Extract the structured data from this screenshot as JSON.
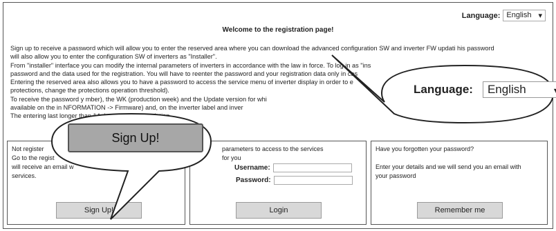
{
  "header": {
    "language_label": "Language:",
    "language_value": "English",
    "title": "Welcome to the registration page!"
  },
  "intro_lines": [
    "Sign up to receive a password which will allow you to enter the reserved area where you can download the advanced configuration SW and inverter FW updati        his password",
    "will also allow you to enter the configuration SW of inverters as \"Installer\".",
    "From \"installer\" interface you can modify the internal parameters of inverters in accordance with the law in force. To log in as \"ins",
    "password and the data used for the registration. You will have to reenter the password and your registration data only in cas",
    "Entering the reserved area also allows you to have a password to access the service menu of inverter display in order to e",
    "protections, change the protections operation threshold).",
    "To receive the password y                                   mber), the WK (production week) and the Update version for whi",
    "available on the in                                           NFORMATION -> Firmware) and, on the inverter label and inver",
    "The entering                                                   last longer than 14 days from its calculation."
  ],
  "boxes": {
    "signup": {
      "lines": [
        "Not register",
        "Go to the regist",
        "will receive an email w",
        "services."
      ],
      "button": "Sign Up!"
    },
    "login": {
      "lines": [
        "parameters to access to the services",
        "for you"
      ],
      "username_label": "Username:",
      "password_label": "Password:",
      "button": "Login"
    },
    "forgot": {
      "lines": [
        "Have you forgotten your password?",
        "",
        "Enter your details and we will send you an email with",
        "your password"
      ],
      "button": "Remember me"
    }
  },
  "callouts": {
    "signup_zoom_label": "Sign Up!",
    "language_zoom_label": "Language:",
    "language_zoom_value": "English"
  }
}
